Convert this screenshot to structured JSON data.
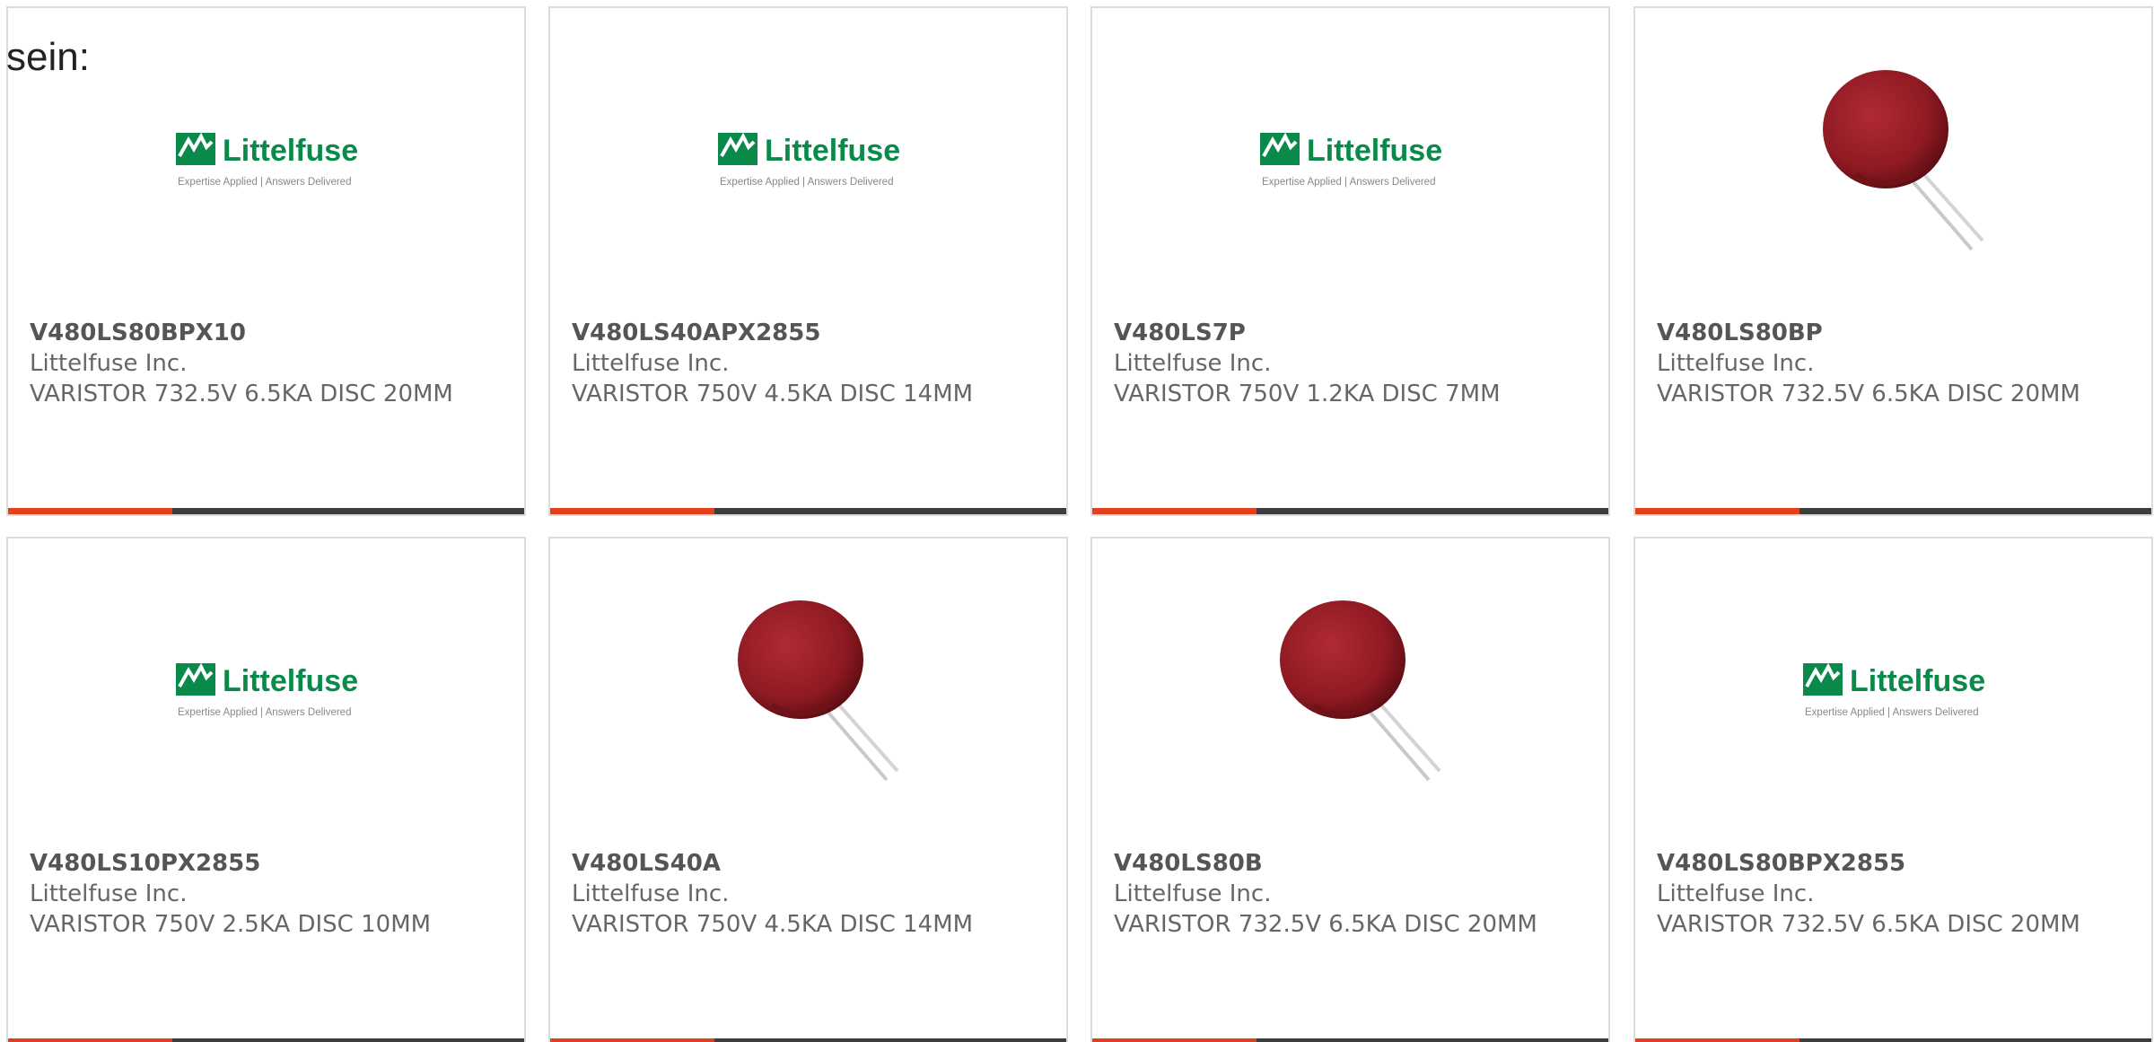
{
  "intro_text": "sein:",
  "colors": {
    "accent": "#e2401c",
    "bar": "#3d3d3d",
    "logo_green": "#0a8a4a",
    "varistor_red": "#8e1a22"
  },
  "logo": {
    "brand": "Littelfuse",
    "tagline": "Expertise Applied | Answers Delivered"
  },
  "products": [
    {
      "part_number": "V480LS80BPX10",
      "manufacturer": "Littelfuse Inc.",
      "description": "VARISTOR 732.5V 6.5KA DISC 20MM",
      "image": "littelfuse-logo"
    },
    {
      "part_number": "V480LS40APX2855",
      "manufacturer": "Littelfuse Inc.",
      "description": "VARISTOR 750V 4.5KA DISC 14MM",
      "image": "littelfuse-logo"
    },
    {
      "part_number": "V480LS7P",
      "manufacturer": "Littelfuse Inc.",
      "description": "VARISTOR 750V 1.2KA DISC 7MM",
      "image": "littelfuse-logo"
    },
    {
      "part_number": "V480LS80BP",
      "manufacturer": "Littelfuse Inc.",
      "description": "VARISTOR 732.5V 6.5KA DISC 20MM",
      "image": "varistor-disc-photo"
    },
    {
      "part_number": "V480LS10PX2855",
      "manufacturer": "Littelfuse Inc.",
      "description": "VARISTOR 750V 2.5KA DISC 10MM",
      "image": "littelfuse-logo"
    },
    {
      "part_number": "V480LS40A",
      "manufacturer": "Littelfuse Inc.",
      "description": "VARISTOR 750V 4.5KA DISC 14MM",
      "image": "varistor-disc-photo"
    },
    {
      "part_number": "V480LS80B",
      "manufacturer": "Littelfuse Inc.",
      "description": "VARISTOR 732.5V 6.5KA DISC 20MM",
      "image": "varistor-disc-photo"
    },
    {
      "part_number": "V480LS80BPX2855",
      "manufacturer": "Littelfuse Inc.",
      "description": "VARISTOR 732.5V 6.5KA DISC 20MM",
      "image": "littelfuse-logo"
    }
  ]
}
